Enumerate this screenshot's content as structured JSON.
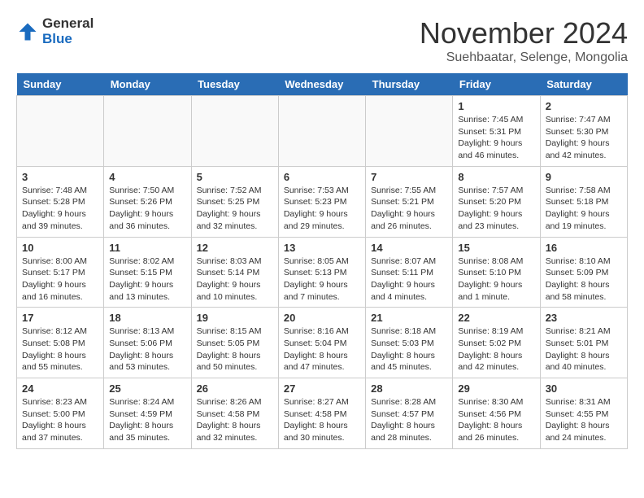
{
  "logo": {
    "general": "General",
    "blue": "Blue"
  },
  "title": "November 2024",
  "subtitle": "Suehbaatar, Selenge, Mongolia",
  "days_of_week": [
    "Sunday",
    "Monday",
    "Tuesday",
    "Wednesday",
    "Thursday",
    "Friday",
    "Saturday"
  ],
  "weeks": [
    [
      {
        "day": "",
        "info": ""
      },
      {
        "day": "",
        "info": ""
      },
      {
        "day": "",
        "info": ""
      },
      {
        "day": "",
        "info": ""
      },
      {
        "day": "",
        "info": ""
      },
      {
        "day": "1",
        "info": "Sunrise: 7:45 AM\nSunset: 5:31 PM\nDaylight: 9 hours and 46 minutes."
      },
      {
        "day": "2",
        "info": "Sunrise: 7:47 AM\nSunset: 5:30 PM\nDaylight: 9 hours and 42 minutes."
      }
    ],
    [
      {
        "day": "3",
        "info": "Sunrise: 7:48 AM\nSunset: 5:28 PM\nDaylight: 9 hours and 39 minutes."
      },
      {
        "day": "4",
        "info": "Sunrise: 7:50 AM\nSunset: 5:26 PM\nDaylight: 9 hours and 36 minutes."
      },
      {
        "day": "5",
        "info": "Sunrise: 7:52 AM\nSunset: 5:25 PM\nDaylight: 9 hours and 32 minutes."
      },
      {
        "day": "6",
        "info": "Sunrise: 7:53 AM\nSunset: 5:23 PM\nDaylight: 9 hours and 29 minutes."
      },
      {
        "day": "7",
        "info": "Sunrise: 7:55 AM\nSunset: 5:21 PM\nDaylight: 9 hours and 26 minutes."
      },
      {
        "day": "8",
        "info": "Sunrise: 7:57 AM\nSunset: 5:20 PM\nDaylight: 9 hours and 23 minutes."
      },
      {
        "day": "9",
        "info": "Sunrise: 7:58 AM\nSunset: 5:18 PM\nDaylight: 9 hours and 19 minutes."
      }
    ],
    [
      {
        "day": "10",
        "info": "Sunrise: 8:00 AM\nSunset: 5:17 PM\nDaylight: 9 hours and 16 minutes."
      },
      {
        "day": "11",
        "info": "Sunrise: 8:02 AM\nSunset: 5:15 PM\nDaylight: 9 hours and 13 minutes."
      },
      {
        "day": "12",
        "info": "Sunrise: 8:03 AM\nSunset: 5:14 PM\nDaylight: 9 hours and 10 minutes."
      },
      {
        "day": "13",
        "info": "Sunrise: 8:05 AM\nSunset: 5:13 PM\nDaylight: 9 hours and 7 minutes."
      },
      {
        "day": "14",
        "info": "Sunrise: 8:07 AM\nSunset: 5:11 PM\nDaylight: 9 hours and 4 minutes."
      },
      {
        "day": "15",
        "info": "Sunrise: 8:08 AM\nSunset: 5:10 PM\nDaylight: 9 hours and 1 minute."
      },
      {
        "day": "16",
        "info": "Sunrise: 8:10 AM\nSunset: 5:09 PM\nDaylight: 8 hours and 58 minutes."
      }
    ],
    [
      {
        "day": "17",
        "info": "Sunrise: 8:12 AM\nSunset: 5:08 PM\nDaylight: 8 hours and 55 minutes."
      },
      {
        "day": "18",
        "info": "Sunrise: 8:13 AM\nSunset: 5:06 PM\nDaylight: 8 hours and 53 minutes."
      },
      {
        "day": "19",
        "info": "Sunrise: 8:15 AM\nSunset: 5:05 PM\nDaylight: 8 hours and 50 minutes."
      },
      {
        "day": "20",
        "info": "Sunrise: 8:16 AM\nSunset: 5:04 PM\nDaylight: 8 hours and 47 minutes."
      },
      {
        "day": "21",
        "info": "Sunrise: 8:18 AM\nSunset: 5:03 PM\nDaylight: 8 hours and 45 minutes."
      },
      {
        "day": "22",
        "info": "Sunrise: 8:19 AM\nSunset: 5:02 PM\nDaylight: 8 hours and 42 minutes."
      },
      {
        "day": "23",
        "info": "Sunrise: 8:21 AM\nSunset: 5:01 PM\nDaylight: 8 hours and 40 minutes."
      }
    ],
    [
      {
        "day": "24",
        "info": "Sunrise: 8:23 AM\nSunset: 5:00 PM\nDaylight: 8 hours and 37 minutes."
      },
      {
        "day": "25",
        "info": "Sunrise: 8:24 AM\nSunset: 4:59 PM\nDaylight: 8 hours and 35 minutes."
      },
      {
        "day": "26",
        "info": "Sunrise: 8:26 AM\nSunset: 4:58 PM\nDaylight: 8 hours and 32 minutes."
      },
      {
        "day": "27",
        "info": "Sunrise: 8:27 AM\nSunset: 4:58 PM\nDaylight: 8 hours and 30 minutes."
      },
      {
        "day": "28",
        "info": "Sunrise: 8:28 AM\nSunset: 4:57 PM\nDaylight: 8 hours and 28 minutes."
      },
      {
        "day": "29",
        "info": "Sunrise: 8:30 AM\nSunset: 4:56 PM\nDaylight: 8 hours and 26 minutes."
      },
      {
        "day": "30",
        "info": "Sunrise: 8:31 AM\nSunset: 4:55 PM\nDaylight: 8 hours and 24 minutes."
      }
    ]
  ]
}
